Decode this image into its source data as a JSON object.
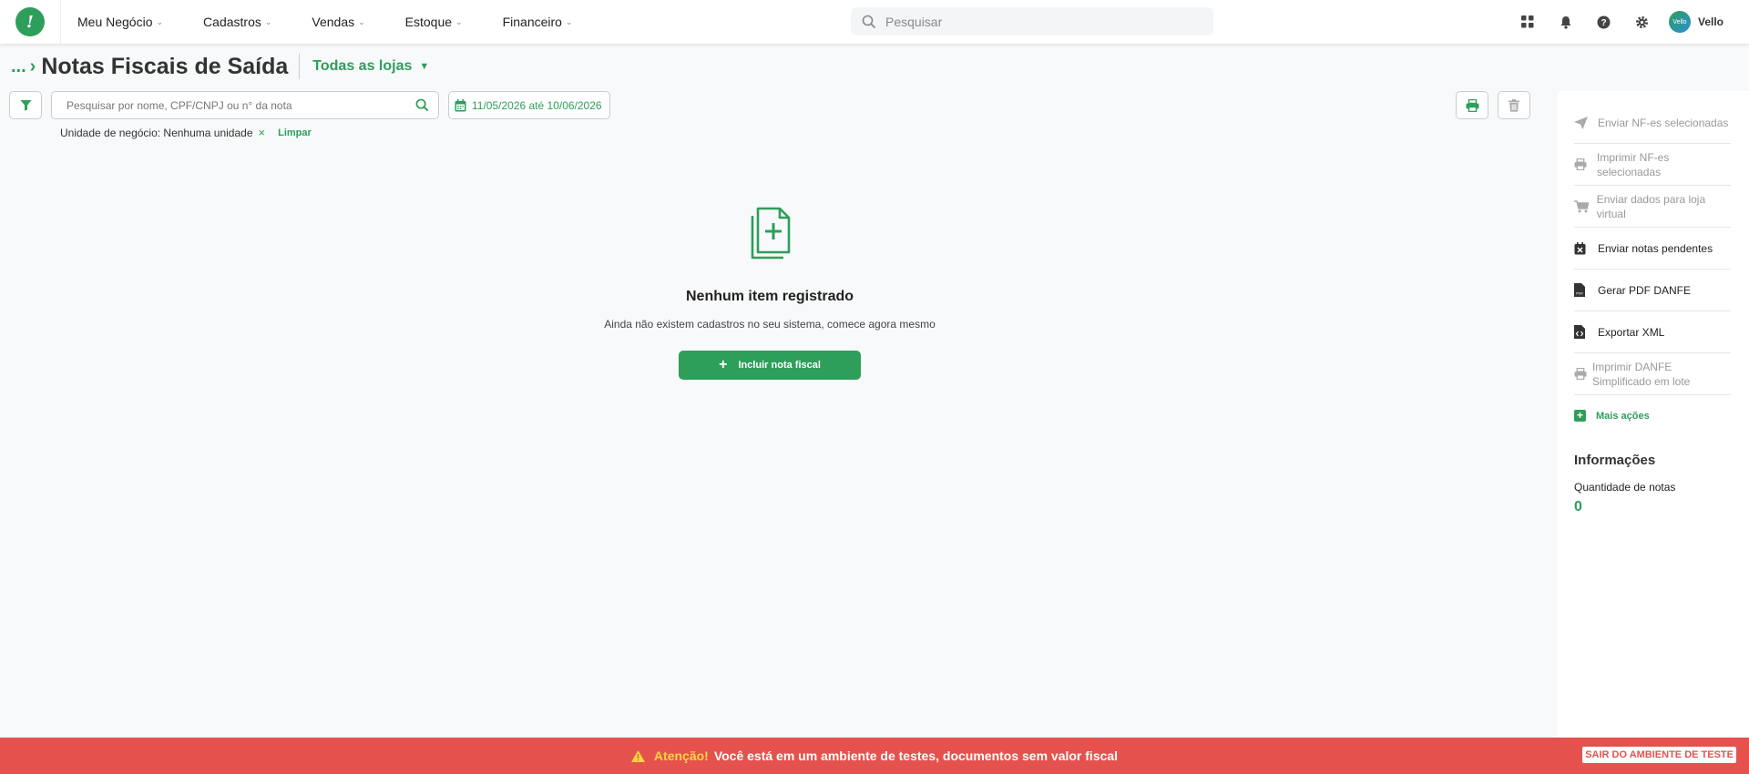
{
  "nav": {
    "items": [
      {
        "label": "Meu Negócio"
      },
      {
        "label": "Cadastros"
      },
      {
        "label": "Vendas"
      },
      {
        "label": "Estoque"
      },
      {
        "label": "Financeiro"
      }
    ],
    "search_placeholder": "Pesquisar",
    "user_name": "Vello",
    "avatar_text": "Vello"
  },
  "header": {
    "breadcrumb": "...",
    "title": "Notas Fiscais de Saída",
    "store_select": "Todas as lojas"
  },
  "filters": {
    "search_placeholder": "Pesquisar por nome, CPF/CNPJ ou n° da nota",
    "date_range": "11/05/2026 até 10/06/2026",
    "chip_label": "Unidade de negócio: Nenhuma unidade",
    "chip_remove": "×",
    "clear_label": "Limpar"
  },
  "empty_state": {
    "title": "Nenhum item registrado",
    "subtitle": "Ainda não existem cadastros no seu sistema, comece agora mesmo",
    "button_label": "Incluir nota fiscal",
    "button_icon": "+"
  },
  "side_panel": {
    "actions": [
      {
        "label": "Enviar NF-es selecionadas",
        "icon": "send-icon",
        "enabled": false
      },
      {
        "label": "Imprimir NF-es selecionadas",
        "icon": "printer-icon",
        "enabled": false
      },
      {
        "label": "Enviar dados para loja virtual",
        "icon": "cart-icon",
        "enabled": false
      },
      {
        "label": "Enviar notas pendentes",
        "icon": "calendar-x-icon",
        "enabled": true
      },
      {
        "label": "Gerar PDF DANFE",
        "icon": "pdf-icon",
        "enabled": true
      },
      {
        "label": "Exportar XML",
        "icon": "xml-file-icon",
        "enabled": true
      },
      {
        "label": "Imprimir DANFE Simplificado em lote",
        "icon": "printer-icon",
        "enabled": false
      }
    ],
    "more_actions": "Mais ações",
    "info_title": "Informações",
    "count_label": "Quantidade de notas",
    "count_value": "0"
  },
  "banner": {
    "attention": "Atenção!",
    "message": "Você está em um ambiente de testes, documentos sem valor fiscal",
    "exit_label": "SAIR DO AMBIENTE DE TESTE"
  },
  "colors": {
    "brand_green": "#2e9e5b",
    "banner_red": "#e5524e",
    "attention_yellow": "#ffd640"
  }
}
